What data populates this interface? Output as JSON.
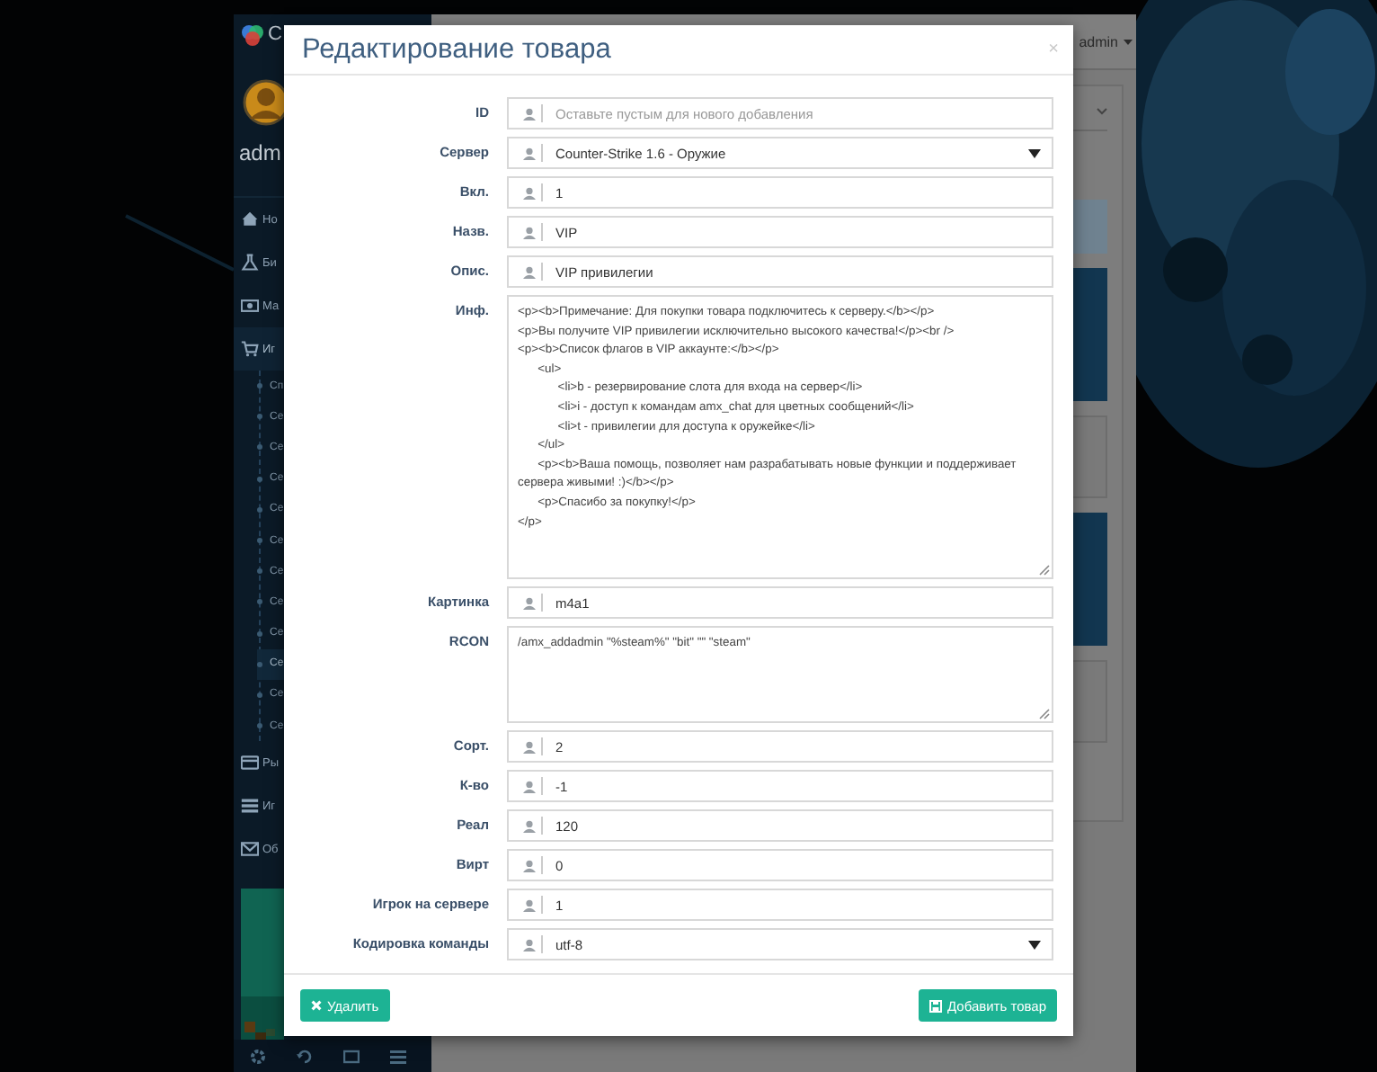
{
  "app": {
    "sidebar": {
      "brand": "C",
      "user": "adm",
      "menu": [
        {
          "label": "Но",
          "selected": false
        },
        {
          "label": "Би",
          "selected": false
        },
        {
          "label": "Ма",
          "selected": false
        },
        {
          "label": "Иг",
          "selected": true,
          "expanded": true,
          "children": [
            {
              "label": "Сп",
              "selected": false
            },
            {
              "label": "Се",
              "selected": false
            },
            {
              "label": "Се",
              "selected": false
            },
            {
              "label": "Се",
              "selected": false
            },
            {
              "label": "Се",
              "selected": false
            },
            {
              "label": "Се",
              "selected": false
            },
            {
              "label": "Се",
              "selected": false
            },
            {
              "label": "Се",
              "selected": false
            },
            {
              "label": "Се",
              "selected": false
            },
            {
              "label": "Се",
              "selected": true
            },
            {
              "label": "Се",
              "selected": false
            },
            {
              "label": "Се",
              "selected": false
            }
          ]
        },
        {
          "label": "Ры",
          "selected": false
        },
        {
          "label": "Иг",
          "selected": false
        },
        {
          "label": "Об",
          "selected": false
        }
      ]
    },
    "header": {
      "user_menu": "admin"
    }
  },
  "modal": {
    "title": "Редактирование товара",
    "close": "×",
    "fields": [
      {
        "label": "ID",
        "kind": "input",
        "placeholder": "Оставьте пустым для нового добавления"
      },
      {
        "label": "Сервер",
        "kind": "select",
        "value": "Counter-Strike 1.6 - Оружие"
      },
      {
        "label": "Вкл.",
        "kind": "input",
        "value": "1"
      },
      {
        "label": "Назв.",
        "kind": "input",
        "value": "VIP"
      },
      {
        "label": "Опис.",
        "kind": "input",
        "value": "VIP привилегии"
      },
      {
        "label": "Инф.",
        "kind": "memo",
        "value": "<p><b>Примечание: Для покупки товара подключитесь к серверу.</b></p>\n<p>Вы получите VIP привилегии исключительно высокого качества!</p><br />\n<p><b>Список флагов в VIP аккаунте:</b></p>\n\t<ul>\n\t\t<li>b - резервирование слота для входа на сервер</li>\n\t\t<li>i - доступ к командам amx_chat для цветных сообщений</li>\n\t\t<li>t - привилегии для доступа к оружейке</li>\n\t</ul>\n\t<p><b>Ваша помощь, позволяет нам разрабатывать новые функции и поддерживает сервера живыми! :)</b></p>\n\t<p>Спасибо за покупку!</p>\n</p>"
      },
      {
        "label": "Картинка",
        "kind": "input",
        "value": "m4a1"
      },
      {
        "label": "RCON",
        "kind": "textarea",
        "value": "/amx_addadmin \"%steam%\" \"bit\" \"\" \"steam\""
      },
      {
        "label": "Сорт.",
        "kind": "input",
        "value": "2"
      },
      {
        "label": "К-во",
        "kind": "input",
        "value": "-1"
      },
      {
        "label": "Реал",
        "kind": "input",
        "value": "120"
      },
      {
        "label": "Вирт",
        "kind": "input",
        "value": "0"
      },
      {
        "label": "Игрок на сервере",
        "kind": "input",
        "value": "1"
      },
      {
        "label": "Кодировка команды",
        "kind": "select",
        "value": "utf-8"
      }
    ],
    "buttons": [
      {
        "label": "Удалить",
        "kind": "delete"
      },
      {
        "label": "Добавить товар",
        "kind": "save"
      }
    ]
  }
}
